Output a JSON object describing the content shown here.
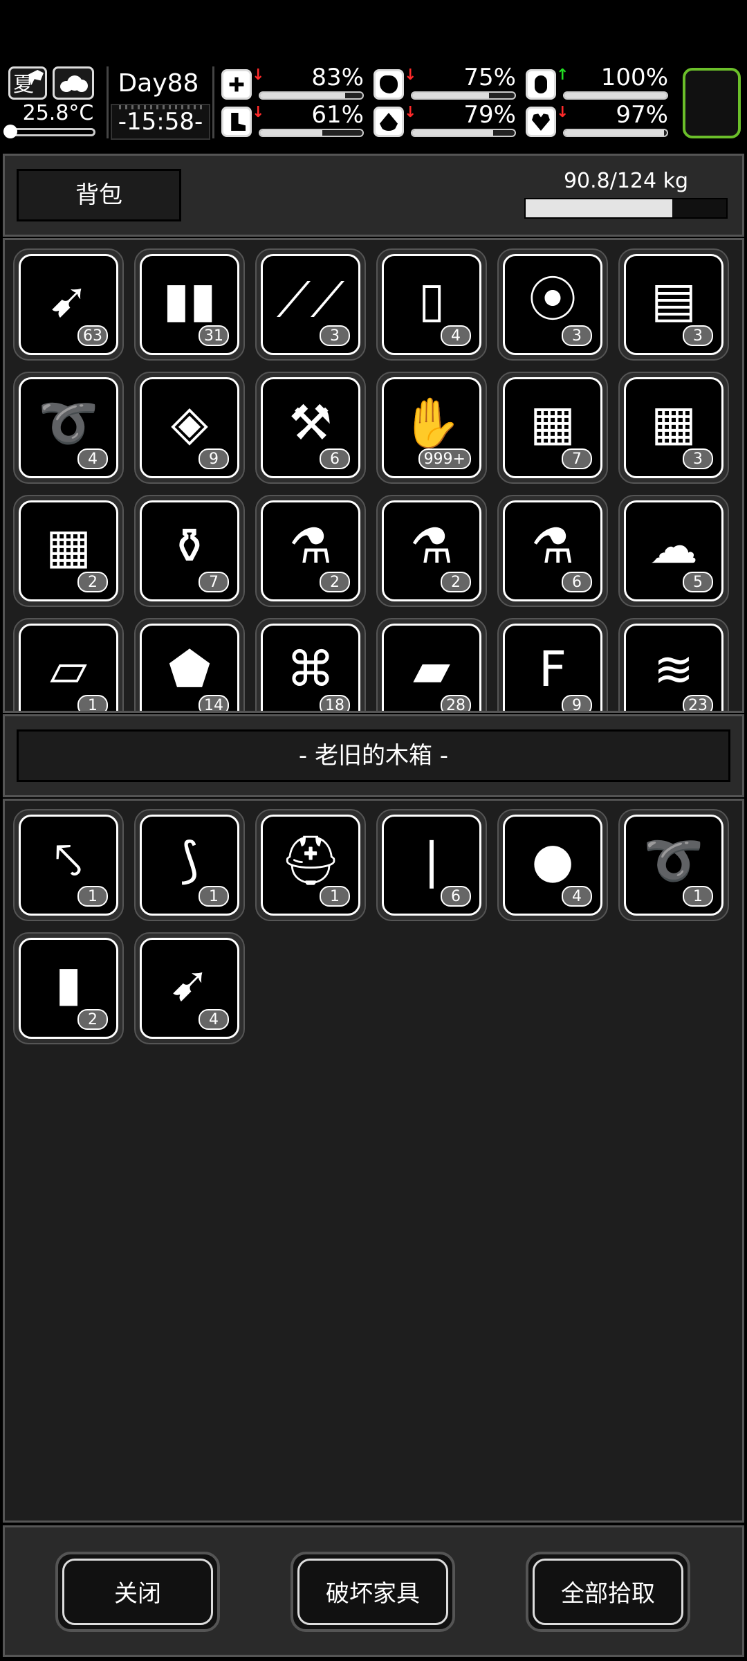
{
  "status": {
    "season": "夏",
    "day": "Day88",
    "time": "-15:58-",
    "temperature": "25.8°C",
    "stats": [
      {
        "name": "health",
        "value": "83%",
        "fill": 0.83,
        "trend": "down",
        "icon": "medkit-icon"
      },
      {
        "name": "hunger",
        "value": "75%",
        "fill": 0.75,
        "trend": "down",
        "icon": "stomach-icon"
      },
      {
        "name": "medicine",
        "value": "100%",
        "fill": 1.0,
        "trend": "up",
        "icon": "pill-icon"
      },
      {
        "name": "stamina",
        "value": "61%",
        "fill": 0.61,
        "trend": "down",
        "icon": "boot-icon"
      },
      {
        "name": "thirst",
        "value": "79%",
        "fill": 0.79,
        "trend": "down",
        "icon": "water-drop-icon"
      },
      {
        "name": "mood",
        "value": "97%",
        "fill": 0.97,
        "trend": "down",
        "icon": "heart-icon"
      }
    ],
    "colors": {
      "down": "#ff2a2a",
      "up": "#22dd22",
      "equip_slot": "#6bbf2a"
    }
  },
  "backpack": {
    "title": "背包",
    "weight": "90.8/124 kg",
    "weight_fill": 0.732,
    "items": [
      {
        "icon": "arrow-icon",
        "count": "63"
      },
      {
        "icon": "bullets-icon",
        "count": "31"
      },
      {
        "icon": "lockpick-icon",
        "count": "3"
      },
      {
        "icon": "water-bottle-icon",
        "count": "4"
      },
      {
        "icon": "meat-skewer-icon",
        "count": "3"
      },
      {
        "icon": "towel-icon",
        "count": "3"
      },
      {
        "icon": "rope-icon",
        "count": "4"
      },
      {
        "icon": "ice-cubes-icon",
        "count": "9"
      },
      {
        "icon": "toolbox-icon",
        "count": "6"
      },
      {
        "icon": "zombie-card-icon",
        "count": "999+"
      },
      {
        "icon": "ammo-crate-icon",
        "count": "7"
      },
      {
        "icon": "ammo-crate-icon",
        "count": "3"
      },
      {
        "icon": "ammo-crate-icon",
        "count": "2"
      },
      {
        "icon": "bottles-icon",
        "count": "7"
      },
      {
        "icon": "potion-vi-icon",
        "count": "2"
      },
      {
        "icon": "potion-v-icon",
        "count": "2"
      },
      {
        "icon": "potion-iv-icon",
        "count": "6"
      },
      {
        "icon": "cloth-icon",
        "count": "5"
      },
      {
        "icon": "paper-icon",
        "count": "1"
      },
      {
        "icon": "stone-icon",
        "count": "14"
      },
      {
        "icon": "scrap-metal-icon",
        "count": "18"
      },
      {
        "icon": "brick-icon",
        "count": "28"
      },
      {
        "icon": "flour-sack-icon",
        "count": "9"
      },
      {
        "icon": "wood-planks-icon",
        "count": "23"
      }
    ]
  },
  "container": {
    "title": "- 老旧的木箱 -",
    "items": [
      {
        "icon": "spear-icon",
        "count": "1"
      },
      {
        "icon": "bow-icon",
        "count": "1"
      },
      {
        "icon": "helmet-icon",
        "count": "1"
      },
      {
        "icon": "rifle-bullet-icon",
        "count": "6"
      },
      {
        "icon": "pistol-rounds-icon",
        "count": "4"
      },
      {
        "icon": "rope-icon",
        "count": "1"
      },
      {
        "icon": "shotgun-shell-icon",
        "count": "2"
      },
      {
        "icon": "arrow-icon",
        "count": "4"
      }
    ]
  },
  "buttons": {
    "close": "关闭",
    "destroy": "破坏家具",
    "take_all": "全部拾取"
  }
}
